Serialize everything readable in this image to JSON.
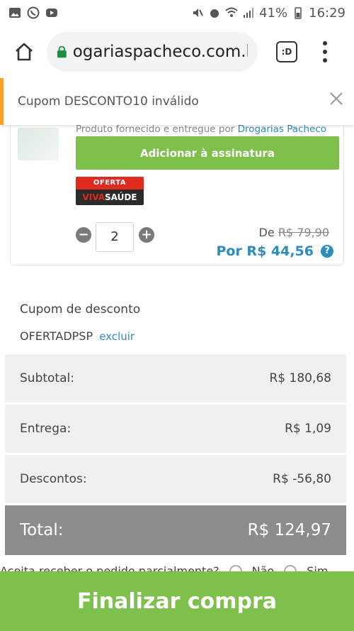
{
  "status_bar": {
    "battery": "41%",
    "time": "16:29"
  },
  "browser": {
    "url": "ogariaspacheco.com.br",
    "tabs_label": ":D"
  },
  "toast": {
    "message": "Cupom DESCONTO10 inválido"
  },
  "product": {
    "provided_by": "Produto fornecido e entregue por",
    "seller": "Drogarias Pacheco",
    "subscription_button": "Adicionar à assinatura",
    "badge_top": "OFERTA",
    "badge_bottom_left": "VIVA",
    "badge_bottom_right": "SAÚDE",
    "quantity": "2",
    "price_de_label": "De",
    "price_old": "R$ 79,90",
    "price_now": "Por R$ 44,56"
  },
  "coupon": {
    "title": "Cupom de desconto",
    "code": "OFERTADPSP",
    "remove_link": "excluir"
  },
  "summary": {
    "rows": [
      {
        "label": "Subtotal:",
        "value": "R$ 180,68"
      },
      {
        "label": "Entrega:",
        "value": "R$ 1,09"
      },
      {
        "label": "Descontos:",
        "value": "R$ -56,80"
      }
    ],
    "total_label": "Total:",
    "total_value": "R$ 124,97"
  },
  "partial_question": {
    "text": "Aceita receber o pedido parcialmente?",
    "no": "Não",
    "yes": "Sim"
  },
  "checkout_button": "Finalizar compra",
  "colors": {
    "green": "#7dc04b",
    "blue": "#2b8cbf",
    "toast_accent": "#f4a22d",
    "total_bg": "#8c8c8c"
  }
}
